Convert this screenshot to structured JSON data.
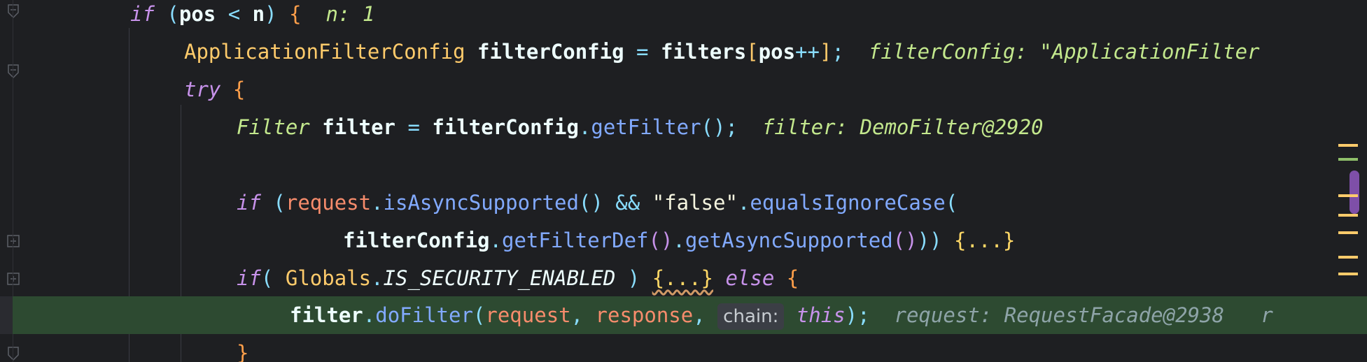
{
  "code": {
    "line1": {
      "kw_if": "if",
      "open": "(",
      "pos": "pos",
      "lt": "<",
      "n": "n",
      "close": ")",
      "brace": "{",
      "hint": "n: 1"
    },
    "line2": {
      "type": "ApplicationFilterConfig",
      "var": "filterConfig",
      "eq": "=",
      "arr": "filters",
      "lb": "[",
      "idx": "pos",
      "inc": "++",
      "rb": "]",
      "semi": ";",
      "hint": "filterConfig: \"ApplicationFilter"
    },
    "line3": {
      "kw_try": "try",
      "brace": "{"
    },
    "line4": {
      "type": "Filter",
      "var": "filter",
      "eq": "=",
      "obj": "filterConfig",
      "dot": ".",
      "meth": "getFilter",
      "parens": "()",
      "semi": ";",
      "hint": "filter: DemoFilter@2920"
    },
    "line6": {
      "kw_if": "if",
      "open": "(",
      "req": "request",
      "dot": ".",
      "meth": "isAsyncSupported",
      "parens": "()",
      "and": "&&",
      "str": "\"false\"",
      "dot2": ".",
      "meth2": "equalsIgnoreCase",
      "open2": "("
    },
    "line7": {
      "obj": "filterConfig",
      "dot": ".",
      "meth": "getFilterDef",
      "parens": "()",
      "dot2": ".",
      "meth2": "getAsyncSupported",
      "parens2": "()",
      "close": "))",
      "fold": "{...}"
    },
    "line8": {
      "kw_if": "if",
      "open": "(",
      "cls": "Globals",
      "dot": ".",
      "const": "IS_SECURITY_ENABLED",
      "close": ")",
      "fold": "{...}",
      "kw_else": "else",
      "brace": "{"
    },
    "line9": {
      "obj": "filter",
      "dot": ".",
      "meth": "doFilter",
      "open": "(",
      "p1": "request",
      "comma1": ",",
      "p2": "response",
      "comma2": ",",
      "chip": "chain:",
      "this": "this",
      "close": ")",
      "semi": ";",
      "hint": "request: RequestFacade@2938",
      "hint_tail": "r"
    },
    "line10": {
      "brace": "}"
    }
  },
  "colors": {
    "background": "#1e1f22",
    "current_line": "#2d4a31",
    "keyword": "#c792ea",
    "type": "#ffcb6b",
    "method": "#82aaff",
    "param": "#f78c6c",
    "inlay": "#c3e88d"
  },
  "icons": [
    "fold-collapse-icon",
    "fold-expand-icon"
  ]
}
